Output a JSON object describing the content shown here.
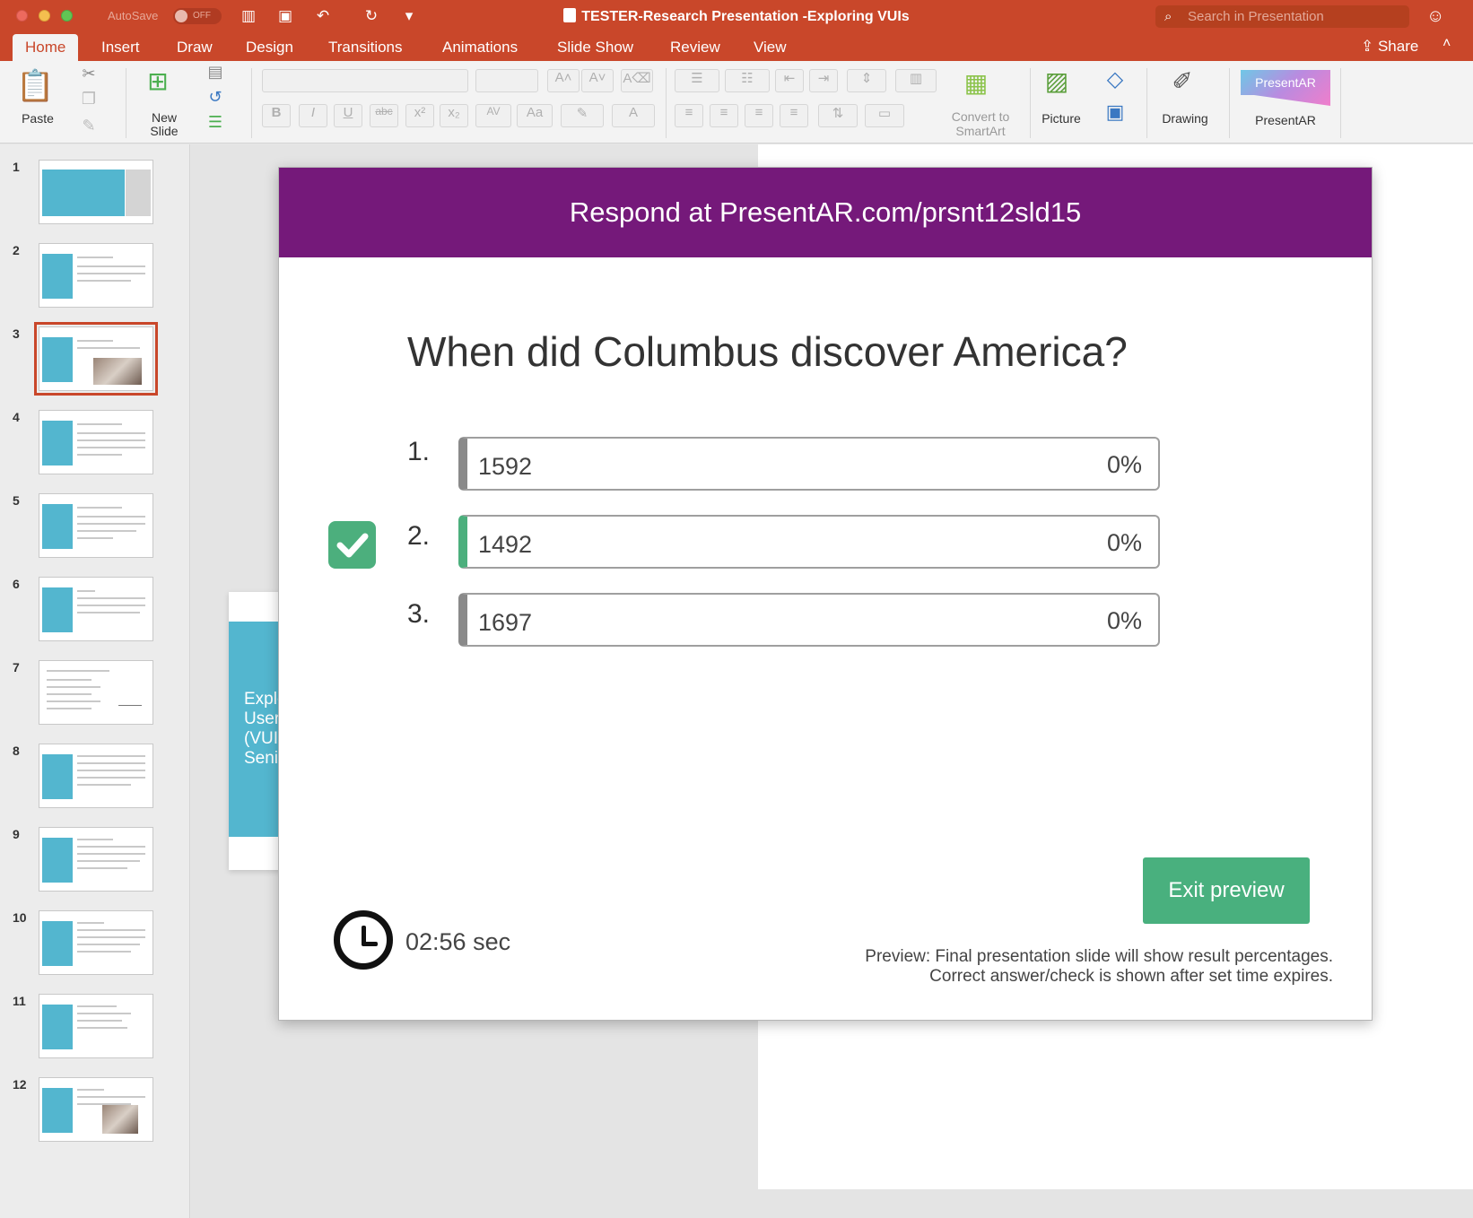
{
  "window": {
    "autosave_label": "AutoSave",
    "autosave_state": "OFF",
    "document_title": "TESTER-Research Presentation -Exploring VUIs",
    "search_placeholder": "Search in Presentation"
  },
  "tabs": [
    "Home",
    "Insert",
    "Draw",
    "Design",
    "Transitions",
    "Animations",
    "Slide Show",
    "Review",
    "View"
  ],
  "active_tab": "Home",
  "share_label": "Share",
  "ribbon": {
    "paste": "Paste",
    "new_slide_line1": "New",
    "new_slide_line2": "Slide",
    "convert_line1": "Convert to",
    "convert_line2": "SmartArt",
    "picture": "Picture",
    "drawing": "Drawing",
    "presentar_logo": "PresentAR",
    "presentar": "PresentAR"
  },
  "thumbnails": {
    "numbers": [
      "1",
      "2",
      "3",
      "4",
      "5",
      "6",
      "7",
      "8",
      "9",
      "10",
      "11",
      "12"
    ],
    "selected": "3"
  },
  "background_slide": {
    "lines": [
      "Explo",
      "User",
      "(VUIs",
      "Seni"
    ]
  },
  "preview": {
    "header": "Respond at PresentAR.com/prsnt12sld15",
    "question": "When did Columbus discover America?",
    "options": [
      {
        "number": "1.",
        "value": "1592",
        "percent": "0%",
        "correct": false
      },
      {
        "number": "2.",
        "value": "1492",
        "percent": "0%",
        "correct": true
      },
      {
        "number": "3.",
        "value": "1697",
        "percent": "0%",
        "correct": false
      }
    ],
    "exit_button": "Exit preview",
    "timer": "02:56 sec",
    "note_line1": "Preview: Final presentation slide will show result percentages.",
    "note_line2": "Correct answer/check is shown after set time expires."
  },
  "colors": {
    "title_bar": "#c9472a",
    "header_purple": "#75197a",
    "accent_green": "#4caf7d",
    "thumb_teal": "#53b6cf"
  }
}
